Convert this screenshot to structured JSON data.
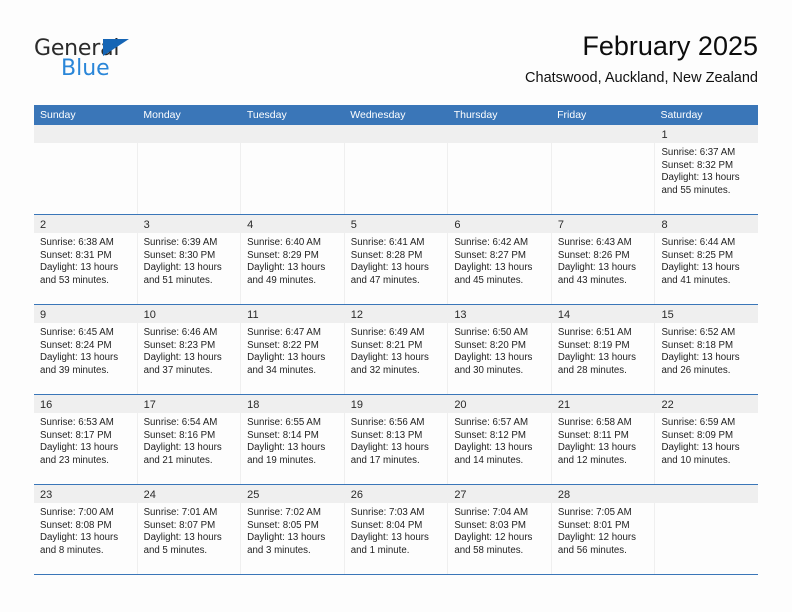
{
  "brand": {
    "name_part1": "General",
    "name_part2": "Blue",
    "triangle_color": "#1565b5",
    "blue_color": "#2a86d8"
  },
  "header": {
    "title": "February 2025",
    "subtitle": "Chatswood, Auckland, New Zealand"
  },
  "colors": {
    "header_blue": "#3a76b8",
    "day_band_gray": "#efefef",
    "page_bg": "#fdfdfd"
  },
  "weekdays": [
    "Sunday",
    "Monday",
    "Tuesday",
    "Wednesday",
    "Thursday",
    "Friday",
    "Saturday"
  ],
  "weeks": [
    [
      {
        "day": "",
        "empty": true
      },
      {
        "day": "",
        "empty": true
      },
      {
        "day": "",
        "empty": true
      },
      {
        "day": "",
        "empty": true
      },
      {
        "day": "",
        "empty": true
      },
      {
        "day": "",
        "empty": true
      },
      {
        "day": "1",
        "sunrise": "Sunrise: 6:37 AM",
        "sunset": "Sunset: 8:32 PM",
        "daylight1": "Daylight: 13 hours",
        "daylight2": "and 55 minutes."
      }
    ],
    [
      {
        "day": "2",
        "sunrise": "Sunrise: 6:38 AM",
        "sunset": "Sunset: 8:31 PM",
        "daylight1": "Daylight: 13 hours",
        "daylight2": "and 53 minutes."
      },
      {
        "day": "3",
        "sunrise": "Sunrise: 6:39 AM",
        "sunset": "Sunset: 8:30 PM",
        "daylight1": "Daylight: 13 hours",
        "daylight2": "and 51 minutes."
      },
      {
        "day": "4",
        "sunrise": "Sunrise: 6:40 AM",
        "sunset": "Sunset: 8:29 PM",
        "daylight1": "Daylight: 13 hours",
        "daylight2": "and 49 minutes."
      },
      {
        "day": "5",
        "sunrise": "Sunrise: 6:41 AM",
        "sunset": "Sunset: 8:28 PM",
        "daylight1": "Daylight: 13 hours",
        "daylight2": "and 47 minutes."
      },
      {
        "day": "6",
        "sunrise": "Sunrise: 6:42 AM",
        "sunset": "Sunset: 8:27 PM",
        "daylight1": "Daylight: 13 hours",
        "daylight2": "and 45 minutes."
      },
      {
        "day": "7",
        "sunrise": "Sunrise: 6:43 AM",
        "sunset": "Sunset: 8:26 PM",
        "daylight1": "Daylight: 13 hours",
        "daylight2": "and 43 minutes."
      },
      {
        "day": "8",
        "sunrise": "Sunrise: 6:44 AM",
        "sunset": "Sunset: 8:25 PM",
        "daylight1": "Daylight: 13 hours",
        "daylight2": "and 41 minutes."
      }
    ],
    [
      {
        "day": "9",
        "sunrise": "Sunrise: 6:45 AM",
        "sunset": "Sunset: 8:24 PM",
        "daylight1": "Daylight: 13 hours",
        "daylight2": "and 39 minutes."
      },
      {
        "day": "10",
        "sunrise": "Sunrise: 6:46 AM",
        "sunset": "Sunset: 8:23 PM",
        "daylight1": "Daylight: 13 hours",
        "daylight2": "and 37 minutes."
      },
      {
        "day": "11",
        "sunrise": "Sunrise: 6:47 AM",
        "sunset": "Sunset: 8:22 PM",
        "daylight1": "Daylight: 13 hours",
        "daylight2": "and 34 minutes."
      },
      {
        "day": "12",
        "sunrise": "Sunrise: 6:49 AM",
        "sunset": "Sunset: 8:21 PM",
        "daylight1": "Daylight: 13 hours",
        "daylight2": "and 32 minutes."
      },
      {
        "day": "13",
        "sunrise": "Sunrise: 6:50 AM",
        "sunset": "Sunset: 8:20 PM",
        "daylight1": "Daylight: 13 hours",
        "daylight2": "and 30 minutes."
      },
      {
        "day": "14",
        "sunrise": "Sunrise: 6:51 AM",
        "sunset": "Sunset: 8:19 PM",
        "daylight1": "Daylight: 13 hours",
        "daylight2": "and 28 minutes."
      },
      {
        "day": "15",
        "sunrise": "Sunrise: 6:52 AM",
        "sunset": "Sunset: 8:18 PM",
        "daylight1": "Daylight: 13 hours",
        "daylight2": "and 26 minutes."
      }
    ],
    [
      {
        "day": "16",
        "sunrise": "Sunrise: 6:53 AM",
        "sunset": "Sunset: 8:17 PM",
        "daylight1": "Daylight: 13 hours",
        "daylight2": "and 23 minutes."
      },
      {
        "day": "17",
        "sunrise": "Sunrise: 6:54 AM",
        "sunset": "Sunset: 8:16 PM",
        "daylight1": "Daylight: 13 hours",
        "daylight2": "and 21 minutes."
      },
      {
        "day": "18",
        "sunrise": "Sunrise: 6:55 AM",
        "sunset": "Sunset: 8:14 PM",
        "daylight1": "Daylight: 13 hours",
        "daylight2": "and 19 minutes."
      },
      {
        "day": "19",
        "sunrise": "Sunrise: 6:56 AM",
        "sunset": "Sunset: 8:13 PM",
        "daylight1": "Daylight: 13 hours",
        "daylight2": "and 17 minutes."
      },
      {
        "day": "20",
        "sunrise": "Sunrise: 6:57 AM",
        "sunset": "Sunset: 8:12 PM",
        "daylight1": "Daylight: 13 hours",
        "daylight2": "and 14 minutes."
      },
      {
        "day": "21",
        "sunrise": "Sunrise: 6:58 AM",
        "sunset": "Sunset: 8:11 PM",
        "daylight1": "Daylight: 13 hours",
        "daylight2": "and 12 minutes."
      },
      {
        "day": "22",
        "sunrise": "Sunrise: 6:59 AM",
        "sunset": "Sunset: 8:09 PM",
        "daylight1": "Daylight: 13 hours",
        "daylight2": "and 10 minutes."
      }
    ],
    [
      {
        "day": "23",
        "sunrise": "Sunrise: 7:00 AM",
        "sunset": "Sunset: 8:08 PM",
        "daylight1": "Daylight: 13 hours",
        "daylight2": "and 8 minutes."
      },
      {
        "day": "24",
        "sunrise": "Sunrise: 7:01 AM",
        "sunset": "Sunset: 8:07 PM",
        "daylight1": "Daylight: 13 hours",
        "daylight2": "and 5 minutes."
      },
      {
        "day": "25",
        "sunrise": "Sunrise: 7:02 AM",
        "sunset": "Sunset: 8:05 PM",
        "daylight1": "Daylight: 13 hours",
        "daylight2": "and 3 minutes."
      },
      {
        "day": "26",
        "sunrise": "Sunrise: 7:03 AM",
        "sunset": "Sunset: 8:04 PM",
        "daylight1": "Daylight: 13 hours",
        "daylight2": "and 1 minute."
      },
      {
        "day": "27",
        "sunrise": "Sunrise: 7:04 AM",
        "sunset": "Sunset: 8:03 PM",
        "daylight1": "Daylight: 12 hours",
        "daylight2": "and 58 minutes."
      },
      {
        "day": "28",
        "sunrise": "Sunrise: 7:05 AM",
        "sunset": "Sunset: 8:01 PM",
        "daylight1": "Daylight: 12 hours",
        "daylight2": "and 56 minutes."
      },
      {
        "day": "",
        "empty": true
      }
    ]
  ]
}
